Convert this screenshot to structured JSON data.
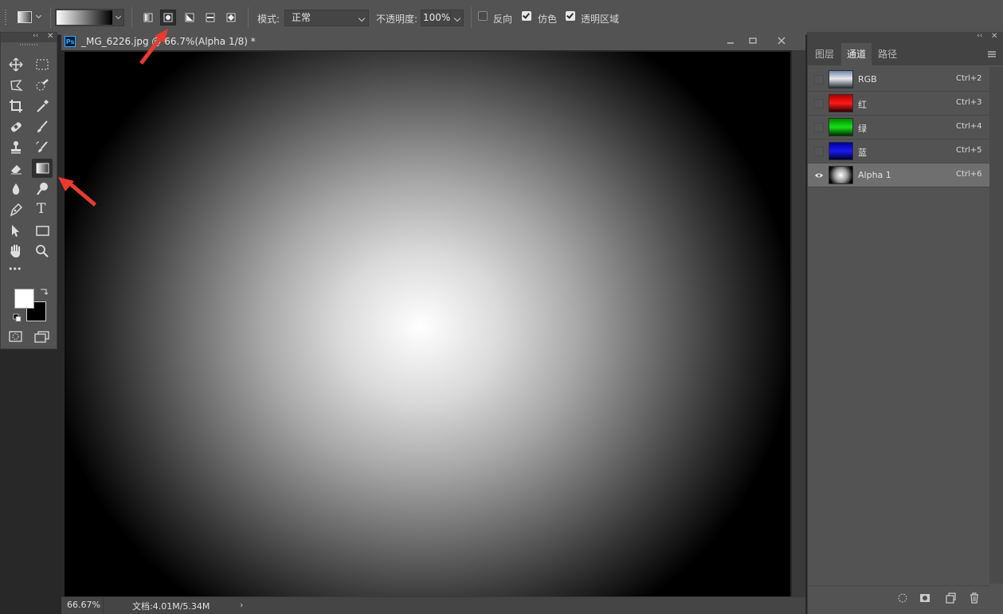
{
  "options_bar": {
    "tool_preset_icon": "gradient-tool-icon",
    "gradient_swatch": "black-white-gradient",
    "gradient_types": [
      {
        "name": "linear",
        "icon": "linear-gradient-icon",
        "selected": false
      },
      {
        "name": "radial",
        "icon": "radial-gradient-icon",
        "selected": true
      },
      {
        "name": "angle",
        "icon": "angle-gradient-icon",
        "selected": false
      },
      {
        "name": "reflected",
        "icon": "reflected-gradient-icon",
        "selected": false
      },
      {
        "name": "diamond",
        "icon": "diamond-gradient-icon",
        "selected": false
      }
    ],
    "mode_label": "模式:",
    "mode_value": "正常",
    "opacity_label": "不透明度:",
    "opacity_value": "100%",
    "reverse_label": "反向",
    "reverse_checked": false,
    "dither_label": "仿色",
    "dither_checked": true,
    "transparency_label": "透明区域",
    "transparency_checked": true
  },
  "toolbox": {
    "tools": [
      {
        "name": "move-tool-icon"
      },
      {
        "name": "marquee-tool-icon"
      },
      {
        "name": "lasso-tool-icon"
      },
      {
        "name": "quick-select-tool-icon"
      },
      {
        "name": "crop-tool-icon"
      },
      {
        "name": "eyedropper-tool-icon"
      },
      {
        "name": "healing-brush-tool-icon"
      },
      {
        "name": "brush-tool-icon"
      },
      {
        "name": "clone-stamp-tool-icon"
      },
      {
        "name": "history-brush-tool-icon"
      },
      {
        "name": "eraser-tool-icon"
      },
      {
        "name": "gradient-tool-icon",
        "active": true
      },
      {
        "name": "blur-tool-icon"
      },
      {
        "name": "dodge-tool-icon"
      },
      {
        "name": "pen-tool-icon"
      },
      {
        "name": "type-tool-icon",
        "glyph": "T"
      },
      {
        "name": "path-select-tool-icon"
      },
      {
        "name": "rectangle-tool-icon"
      },
      {
        "name": "hand-tool-icon"
      },
      {
        "name": "zoom-tool-icon"
      },
      {
        "name": "more-tools-icon",
        "glyph": "•••"
      }
    ],
    "foreground_color": "#ffffff",
    "background_color": "#000000"
  },
  "document": {
    "app_badge": "Ps",
    "title": "_MG_6226.jpg @ 66.7%(Alpha 1/8) *",
    "status_zoom": "66.67%",
    "status_doc": "文档:4.01M/5.34M"
  },
  "panel": {
    "tabs": [
      {
        "label": "图层",
        "active": false
      },
      {
        "label": "通道",
        "active": true
      },
      {
        "label": "路径",
        "active": false
      }
    ],
    "channels": [
      {
        "name": "RGB",
        "shortcut": "Ctrl+2",
        "thumb_color": "#7d8fa8",
        "visible": false,
        "active": false
      },
      {
        "name": "红",
        "shortcut": "Ctrl+3",
        "thumb_color": "#e00000",
        "visible": false,
        "active": false
      },
      {
        "name": "绿",
        "shortcut": "Ctrl+4",
        "thumb_color": "#00c800",
        "visible": false,
        "active": false
      },
      {
        "name": "蓝",
        "shortcut": "Ctrl+5",
        "thumb_color": "#0000d8",
        "visible": false,
        "active": false
      },
      {
        "name": "Alpha 1",
        "shortcut": "Ctrl+6",
        "thumb_color": "radial",
        "visible": true,
        "active": true
      }
    ],
    "footer_icons": [
      "load-selection-icon",
      "save-selection-icon",
      "new-channel-icon",
      "delete-channel-icon"
    ]
  },
  "annotations": {
    "arrow_color": "#e83a2f"
  }
}
